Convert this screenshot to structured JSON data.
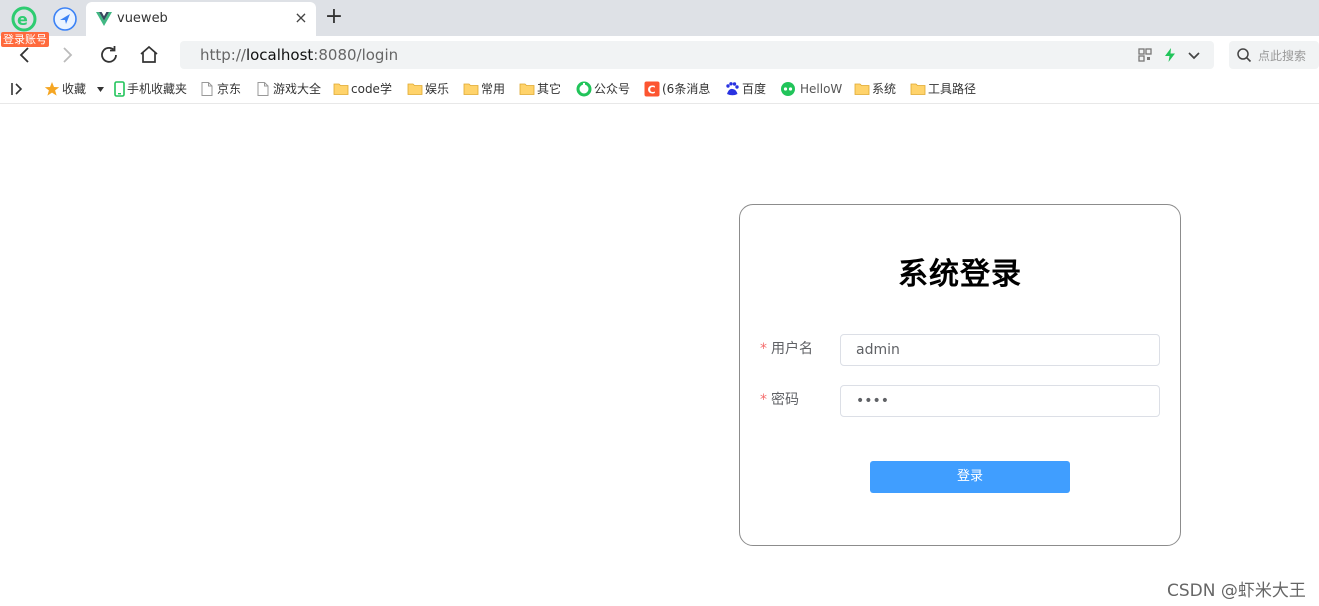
{
  "browser": {
    "login_badge": "登录账号",
    "tab": {
      "title": "vueweb",
      "close": "×"
    },
    "new_tab": "+",
    "url": {
      "scheme": "http://",
      "host": "localhost",
      "rest": ":8080/login"
    },
    "search_placeholder": "点此搜索"
  },
  "bookmarks": [
    {
      "label": "收藏",
      "icon": "star-icon"
    },
    {
      "label": "手机收藏夹",
      "icon": "phone-icon"
    },
    {
      "label": "京东",
      "icon": "page-icon"
    },
    {
      "label": "游戏大全",
      "icon": "page-icon"
    },
    {
      "label": "code学",
      "icon": "folder-icon"
    },
    {
      "label": "娱乐",
      "icon": "folder-icon"
    },
    {
      "label": "常用",
      "icon": "folder-icon"
    },
    {
      "label": "其它",
      "icon": "folder-icon"
    },
    {
      "label": "公众号",
      "icon": "green-circle-icon"
    },
    {
      "label": "(6条消息",
      "icon": "csdn-icon"
    },
    {
      "label": "百度",
      "icon": "baidu-icon"
    },
    {
      "label": "HelloW",
      "icon": "wechat-icon"
    },
    {
      "label": "系统",
      "icon": "folder-icon"
    },
    {
      "label": "工具路径",
      "icon": "folder-icon"
    }
  ],
  "login": {
    "title": "系统登录",
    "username_label": "用户名",
    "username_value": "admin",
    "password_label": "密码",
    "password_value": "••••",
    "required_mark": "*",
    "submit_label": "登录"
  },
  "colors": {
    "primary": "#409eff",
    "required": "#f56c6c"
  },
  "watermark": "CSDN @虾米大王"
}
